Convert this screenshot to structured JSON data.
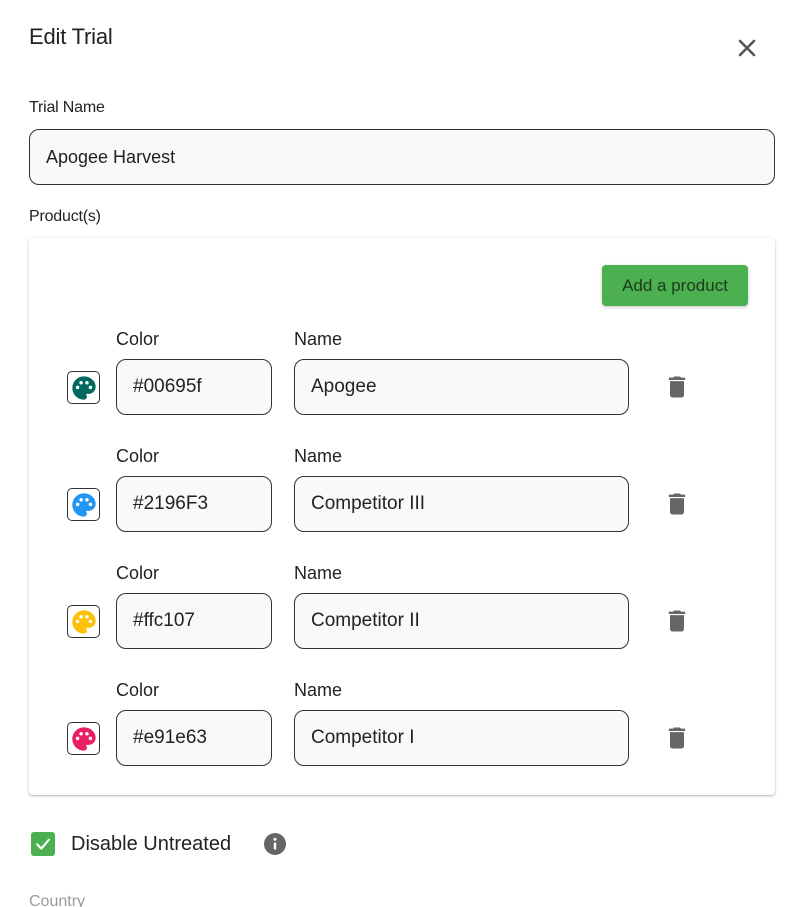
{
  "dialog": {
    "title": "Edit Trial"
  },
  "trial": {
    "label": "Trial Name",
    "value": "Apogee Harvest"
  },
  "products": {
    "label": "Product(s)",
    "add_label": "Add a product",
    "color_header": "Color",
    "name_header": "Name",
    "items": [
      {
        "color": "#00695f",
        "name": "Apogee"
      },
      {
        "color": "#2196F3",
        "name": "Competitor III"
      },
      {
        "color": "#ffc107",
        "name": "Competitor II"
      },
      {
        "color": "#e91e63",
        "name": "Competitor I"
      }
    ]
  },
  "disable_untreated": {
    "label": "Disable Untreated",
    "checked": true
  },
  "country": {
    "label": "Country"
  },
  "colors": {
    "accent_green": "#4caf50"
  },
  "icons": {
    "close": "close-icon",
    "palette": "palette-icon",
    "trash": "trash-icon",
    "info": "info-icon",
    "check": "check-icon"
  }
}
